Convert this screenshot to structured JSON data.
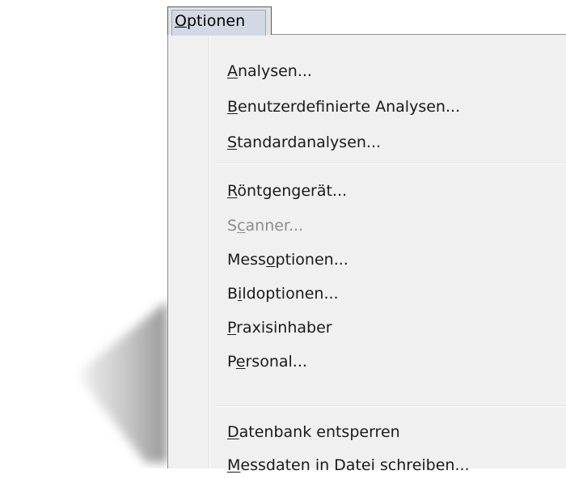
{
  "menubar": {
    "title": "Optionen",
    "mnemonic_index": 0
  },
  "menu": {
    "groups": [
      [
        {
          "label": "Analysen...",
          "mnemonic_index": 0,
          "enabled": true
        },
        {
          "label": "Benutzerdefinierte Analysen...",
          "mnemonic_index": 0,
          "enabled": true
        },
        {
          "label": "Standardanalysen...",
          "mnemonic_index": 0,
          "enabled": true
        }
      ],
      [
        {
          "label": "Röntgengerät...",
          "mnemonic_index": 0,
          "enabled": true
        },
        {
          "label": "Scanner...",
          "mnemonic_index": 1,
          "enabled": false
        },
        {
          "label": "Messoptionen...",
          "mnemonic_index": 4,
          "enabled": true
        },
        {
          "label": "Bildoptionen...",
          "mnemonic_index": 1,
          "enabled": true
        },
        {
          "label": "Praxisinhaber",
          "mnemonic_index": 0,
          "enabled": true
        },
        {
          "label": "Personal...",
          "mnemonic_index": 1,
          "enabled": true
        }
      ],
      [
        {
          "label": "Datenbank entsperren",
          "mnemonic_index": 0,
          "enabled": true
        },
        {
          "label": "Messdaten in Datei schreiben...",
          "mnemonic_index": 0,
          "enabled": true
        }
      ]
    ]
  },
  "colors": {
    "menu_background": "#f0f0f0",
    "menubar_highlight": "#d2d9e4",
    "text": "#1a1a1a",
    "disabled_text": "#8d8d8d"
  }
}
